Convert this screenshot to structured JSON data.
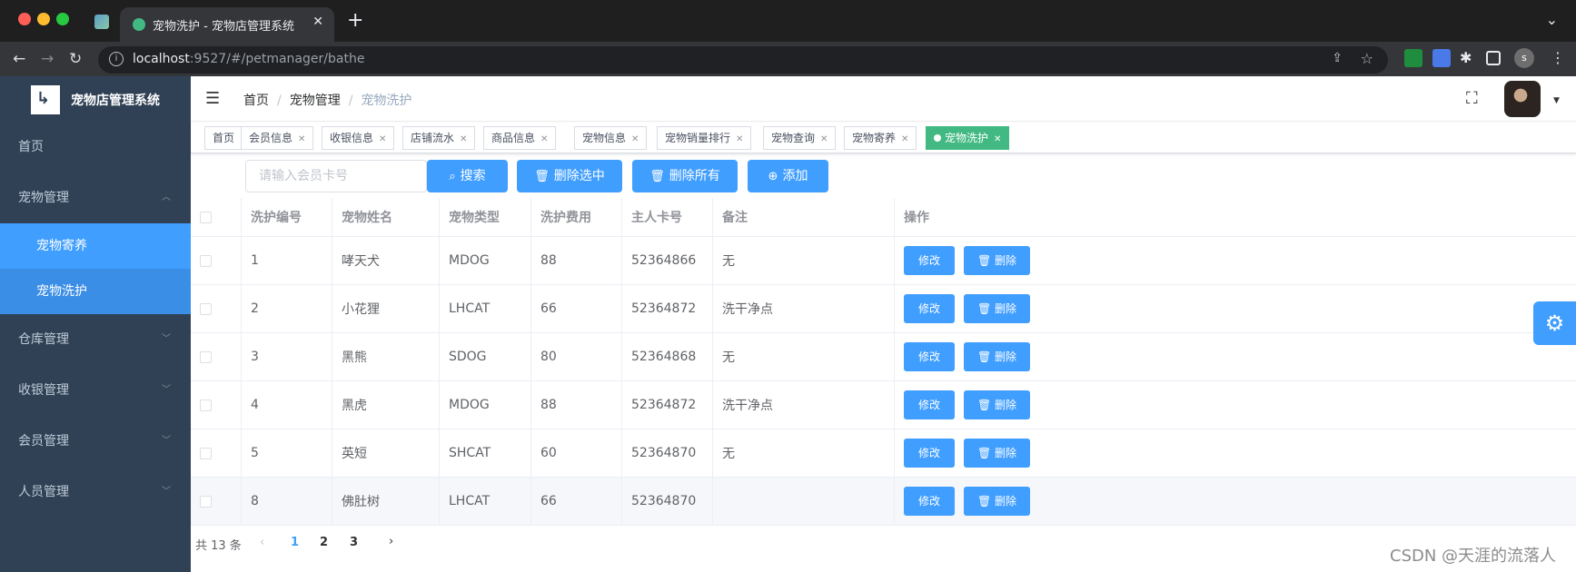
{
  "browser": {
    "tab_title": "宠物洗护 - 宠物店管理系统",
    "url_host": "localhost",
    "url_rest": ":9527/#/petmanager/bathe",
    "profile_letter": "s",
    "icons": [
      "back-icon",
      "forward-icon",
      "reload-icon",
      "info-icon",
      "share-icon",
      "star-icon",
      "extensions-icon",
      "sidebar-icon"
    ]
  },
  "sidebar": {
    "title": "宠物店管理系统",
    "items": [
      {
        "label": "首页"
      },
      {
        "label": "宠物管理",
        "expanded": true,
        "children": [
          "宠物寄养",
          "宠物洗护"
        ]
      },
      {
        "label": "仓库管理"
      },
      {
        "label": "收银管理"
      },
      {
        "label": "会员管理"
      },
      {
        "label": "人员管理"
      }
    ],
    "colors": {
      "bg": "#304156",
      "active": "#409eff"
    }
  },
  "breadcrumb": [
    "首页",
    "宠物管理",
    "宠物洗护"
  ],
  "tags": [
    {
      "label": "首页",
      "closable": false
    },
    {
      "label": "会员信息",
      "closable": true
    },
    {
      "label": "收银信息",
      "closable": true
    },
    {
      "label": "店铺流水",
      "closable": true
    },
    {
      "label": "商品信息",
      "closable": true
    },
    {
      "label": "宠物信息",
      "closable": true
    },
    {
      "label": "宠物销量排行",
      "closable": true
    },
    {
      "label": "宠物查询",
      "closable": true
    },
    {
      "label": "宠物寄养",
      "closable": true
    },
    {
      "label": "宠物洗护",
      "closable": true,
      "active": true
    }
  ],
  "toolbar": {
    "search_placeholder": "请输入会员卡号",
    "search_label": "搜索",
    "delete_selected_label": "删除选中",
    "delete_all_label": "删除所有",
    "add_label": "添加"
  },
  "table": {
    "columns": [
      "洗护编号",
      "宠物姓名",
      "宠物类型",
      "洗护费用",
      "主人卡号",
      "备注",
      "操作"
    ],
    "rows": [
      [
        "1",
        "哮天犬",
        "MDOG",
        "88",
        "52364866",
        "无"
      ],
      [
        "2",
        "小花狸",
        "LHCAT",
        "66",
        "52364872",
        "洗干净点"
      ],
      [
        "3",
        "黑熊",
        "SDOG",
        "80",
        "52364868",
        "无"
      ],
      [
        "4",
        "黑虎",
        "MDOG",
        "88",
        "52364872",
        "洗干净点"
      ],
      [
        "5",
        "英短",
        "SHCAT",
        "60",
        "52364870",
        "无"
      ],
      [
        "8",
        "佛肚树",
        "LHCAT",
        "66",
        "52364870",
        ""
      ]
    ],
    "edit_label": "修改",
    "delete_label": "删除"
  },
  "pagination": {
    "total_text": "共 13 条",
    "pages": [
      "1",
      "2",
      "3"
    ],
    "current_page": "1"
  },
  "watermark": "CSDN @天涯的流落人"
}
